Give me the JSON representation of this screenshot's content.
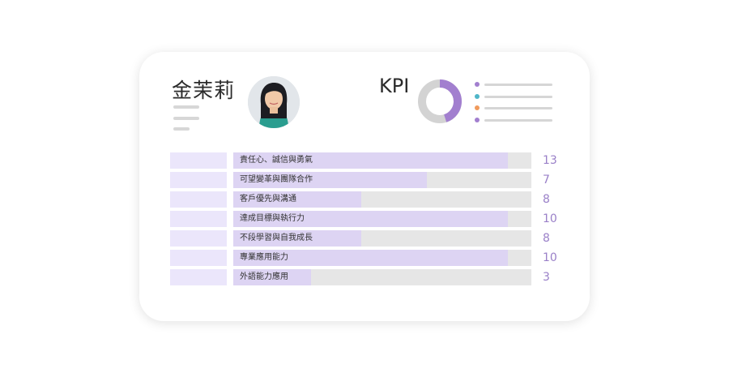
{
  "profile": {
    "name": "金茉莉",
    "avatar_icon": "person-photo"
  },
  "kpi": {
    "label": "KPI",
    "donut": {
      "filled_fraction": 0.45,
      "fill_color": "#a27fcf",
      "rest_color": "#d3d3d3"
    },
    "legend_colors": [
      "#a27fcf",
      "#4fb6c8",
      "#f09a5c",
      "#a27fcf"
    ]
  },
  "rows": [
    {
      "label": "責任心、誠信與勇氣",
      "value": "13",
      "fill_fraction": 0.92
    },
    {
      "label": "可望變革與團隊合作",
      "value": "7",
      "fill_fraction": 0.65
    },
    {
      "label": "客戶優先與溝通",
      "value": "8",
      "fill_fraction": 0.43
    },
    {
      "label": "達成目標與執行力",
      "value": "10",
      "fill_fraction": 0.92
    },
    {
      "label": "不段學習與自我成長",
      "value": "8",
      "fill_fraction": 0.43
    },
    {
      "label": "專業應用能力",
      "value": "10",
      "fill_fraction": 0.92
    },
    {
      "label": "外語能力應用",
      "value": "3",
      "fill_fraction": 0.26
    }
  ],
  "colors": {
    "accent": "#9a80c8",
    "bar_fill": "#ddd4f3",
    "bar_track": "#e6e6e6",
    "tag": "#ebe6fb"
  }
}
